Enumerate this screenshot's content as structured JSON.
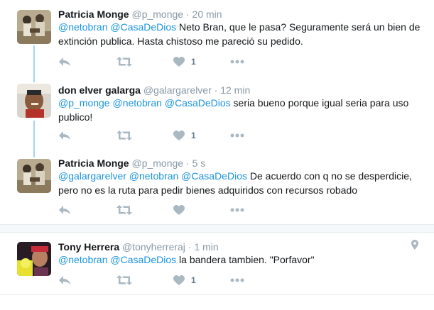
{
  "tweets": [
    {
      "name": "Patricia Monge",
      "handle": "@p_monge",
      "separator": "·",
      "time": "20 min",
      "mentions": "@netobran @CasaDeDios",
      "text": " Neto Bran, que le pasa?  Seguramente será un bien de extinción publica. Hasta chistoso me pareció su pedido.",
      "like_count": "1"
    },
    {
      "name": "don elver galarga",
      "handle": "@galargarelver",
      "separator": "·",
      "time": "12 min",
      "mentions": "@p_monge @netobran @CasaDeDios",
      "text": " seria bueno porque igual seria para uso publico!",
      "like_count": "1"
    },
    {
      "name": "Patricia Monge",
      "handle": "@p_monge",
      "separator": "·",
      "time": "5 s",
      "mentions": "@galargarelver @netobran @CasaDeDios",
      "text": " De acuerdo con q no se desperdicie, pero no es la ruta para pedir bienes adquiridos con recursos robado",
      "like_count": ""
    },
    {
      "name": "Tony Herrera",
      "handle": "@tonyherreraj",
      "separator": "·",
      "time": "1 min",
      "mentions": "@netobran @CasaDeDios",
      "text": " la bandera tambien. \"Porfavor\"",
      "like_count": "1"
    }
  ],
  "colors": {
    "mention": "#1b95e0",
    "icon": "#aab8c2",
    "thread_line": "#a3d5f5"
  },
  "icons": [
    "reply-icon",
    "retweet-icon",
    "like-icon",
    "more-icon",
    "location-pin-icon"
  ]
}
